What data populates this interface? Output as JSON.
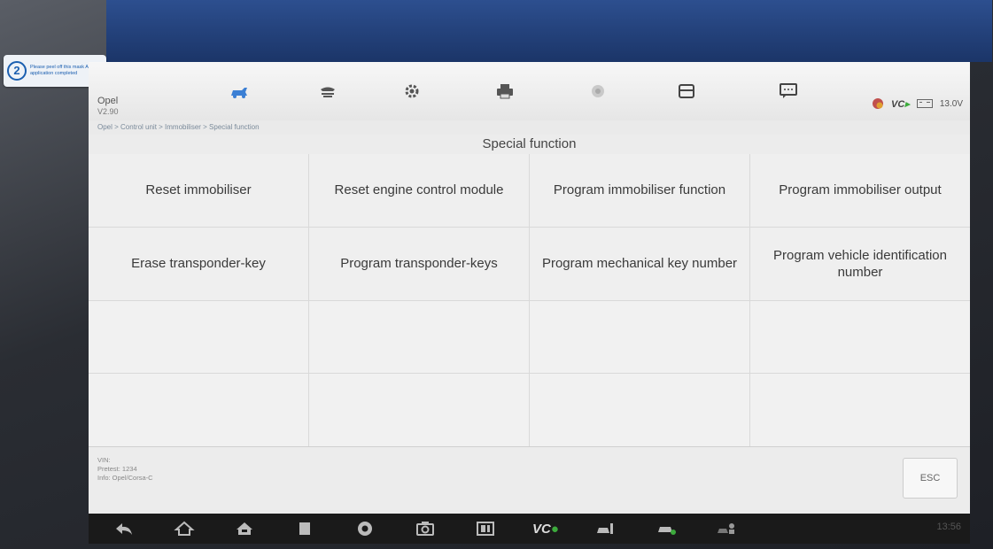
{
  "sticker": {
    "number": "2",
    "text": "Please peel off this mask AFTER application completed"
  },
  "app": {
    "brand": "Opel",
    "version": "V2.90"
  },
  "toolbar": {
    "icons": [
      "vehicle-icon",
      "vehicle-lift-icon",
      "gear-icon",
      "printer-icon",
      "help-icon",
      "save-icon",
      "message-icon"
    ]
  },
  "status": {
    "vci": "VC",
    "voltage": "13.0V"
  },
  "breadcrumb": "Opel > Control unit > Immobiliser > Special function",
  "page_title": "Special function",
  "functions": [
    "Reset immobiliser",
    "Reset engine control module",
    "Program immobiliser function",
    "Program immobiliser output",
    "Erase transponder-key",
    "Program transponder-keys",
    "Program mechanical key number",
    "Program vehicle identification number"
  ],
  "footer": {
    "vin": "VIN:",
    "pretest": "Pretest: 1234",
    "info": "Info: Opel/Corsa-C",
    "esc": "ESC"
  },
  "navbar": {
    "icons": [
      "back-icon",
      "home-icon",
      "house-icon",
      "recent-apps-icon",
      "browser-icon",
      "camera-icon",
      "screenshot-icon",
      "vci-icon",
      "vehicle-plus-icon",
      "car-icon",
      "service-icon"
    ],
    "clock": "13:56"
  },
  "colors": {
    "frame_blue": "#1b3568",
    "vci_green": "#3caa3c"
  }
}
